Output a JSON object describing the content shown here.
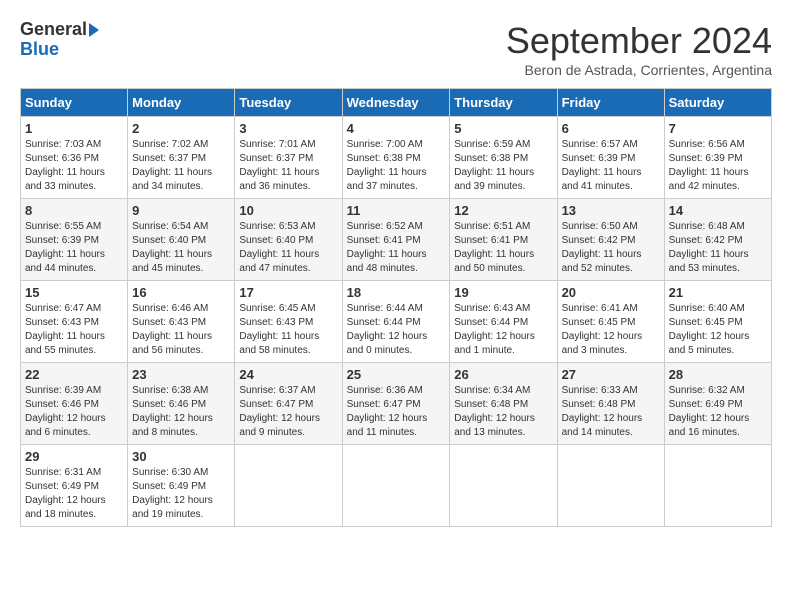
{
  "header": {
    "logo_line1": "General",
    "logo_line2": "Blue",
    "month": "September 2024",
    "location": "Beron de Astrada, Corrientes, Argentina"
  },
  "weekdays": [
    "Sunday",
    "Monday",
    "Tuesday",
    "Wednesday",
    "Thursday",
    "Friday",
    "Saturday"
  ],
  "weeks": [
    [
      {
        "day": "1",
        "info": "Sunrise: 7:03 AM\nSunset: 6:36 PM\nDaylight: 11 hours\nand 33 minutes."
      },
      {
        "day": "2",
        "info": "Sunrise: 7:02 AM\nSunset: 6:37 PM\nDaylight: 11 hours\nand 34 minutes."
      },
      {
        "day": "3",
        "info": "Sunrise: 7:01 AM\nSunset: 6:37 PM\nDaylight: 11 hours\nand 36 minutes."
      },
      {
        "day": "4",
        "info": "Sunrise: 7:00 AM\nSunset: 6:38 PM\nDaylight: 11 hours\nand 37 minutes."
      },
      {
        "day": "5",
        "info": "Sunrise: 6:59 AM\nSunset: 6:38 PM\nDaylight: 11 hours\nand 39 minutes."
      },
      {
        "day": "6",
        "info": "Sunrise: 6:57 AM\nSunset: 6:39 PM\nDaylight: 11 hours\nand 41 minutes."
      },
      {
        "day": "7",
        "info": "Sunrise: 6:56 AM\nSunset: 6:39 PM\nDaylight: 11 hours\nand 42 minutes."
      }
    ],
    [
      {
        "day": "8",
        "info": "Sunrise: 6:55 AM\nSunset: 6:39 PM\nDaylight: 11 hours\nand 44 minutes."
      },
      {
        "day": "9",
        "info": "Sunrise: 6:54 AM\nSunset: 6:40 PM\nDaylight: 11 hours\nand 45 minutes."
      },
      {
        "day": "10",
        "info": "Sunrise: 6:53 AM\nSunset: 6:40 PM\nDaylight: 11 hours\nand 47 minutes."
      },
      {
        "day": "11",
        "info": "Sunrise: 6:52 AM\nSunset: 6:41 PM\nDaylight: 11 hours\nand 48 minutes."
      },
      {
        "day": "12",
        "info": "Sunrise: 6:51 AM\nSunset: 6:41 PM\nDaylight: 11 hours\nand 50 minutes."
      },
      {
        "day": "13",
        "info": "Sunrise: 6:50 AM\nSunset: 6:42 PM\nDaylight: 11 hours\nand 52 minutes."
      },
      {
        "day": "14",
        "info": "Sunrise: 6:48 AM\nSunset: 6:42 PM\nDaylight: 11 hours\nand 53 minutes."
      }
    ],
    [
      {
        "day": "15",
        "info": "Sunrise: 6:47 AM\nSunset: 6:43 PM\nDaylight: 11 hours\nand 55 minutes."
      },
      {
        "day": "16",
        "info": "Sunrise: 6:46 AM\nSunset: 6:43 PM\nDaylight: 11 hours\nand 56 minutes."
      },
      {
        "day": "17",
        "info": "Sunrise: 6:45 AM\nSunset: 6:43 PM\nDaylight: 11 hours\nand 58 minutes."
      },
      {
        "day": "18",
        "info": "Sunrise: 6:44 AM\nSunset: 6:44 PM\nDaylight: 12 hours\nand 0 minutes."
      },
      {
        "day": "19",
        "info": "Sunrise: 6:43 AM\nSunset: 6:44 PM\nDaylight: 12 hours\nand 1 minute."
      },
      {
        "day": "20",
        "info": "Sunrise: 6:41 AM\nSunset: 6:45 PM\nDaylight: 12 hours\nand 3 minutes."
      },
      {
        "day": "21",
        "info": "Sunrise: 6:40 AM\nSunset: 6:45 PM\nDaylight: 12 hours\nand 5 minutes."
      }
    ],
    [
      {
        "day": "22",
        "info": "Sunrise: 6:39 AM\nSunset: 6:46 PM\nDaylight: 12 hours\nand 6 minutes."
      },
      {
        "day": "23",
        "info": "Sunrise: 6:38 AM\nSunset: 6:46 PM\nDaylight: 12 hours\nand 8 minutes."
      },
      {
        "day": "24",
        "info": "Sunrise: 6:37 AM\nSunset: 6:47 PM\nDaylight: 12 hours\nand 9 minutes."
      },
      {
        "day": "25",
        "info": "Sunrise: 6:36 AM\nSunset: 6:47 PM\nDaylight: 12 hours\nand 11 minutes."
      },
      {
        "day": "26",
        "info": "Sunrise: 6:34 AM\nSunset: 6:48 PM\nDaylight: 12 hours\nand 13 minutes."
      },
      {
        "day": "27",
        "info": "Sunrise: 6:33 AM\nSunset: 6:48 PM\nDaylight: 12 hours\nand 14 minutes."
      },
      {
        "day": "28",
        "info": "Sunrise: 6:32 AM\nSunset: 6:49 PM\nDaylight: 12 hours\nand 16 minutes."
      }
    ],
    [
      {
        "day": "29",
        "info": "Sunrise: 6:31 AM\nSunset: 6:49 PM\nDaylight: 12 hours\nand 18 minutes."
      },
      {
        "day": "30",
        "info": "Sunrise: 6:30 AM\nSunset: 6:49 PM\nDaylight: 12 hours\nand 19 minutes."
      },
      {
        "day": "",
        "info": ""
      },
      {
        "day": "",
        "info": ""
      },
      {
        "day": "",
        "info": ""
      },
      {
        "day": "",
        "info": ""
      },
      {
        "day": "",
        "info": ""
      }
    ]
  ]
}
